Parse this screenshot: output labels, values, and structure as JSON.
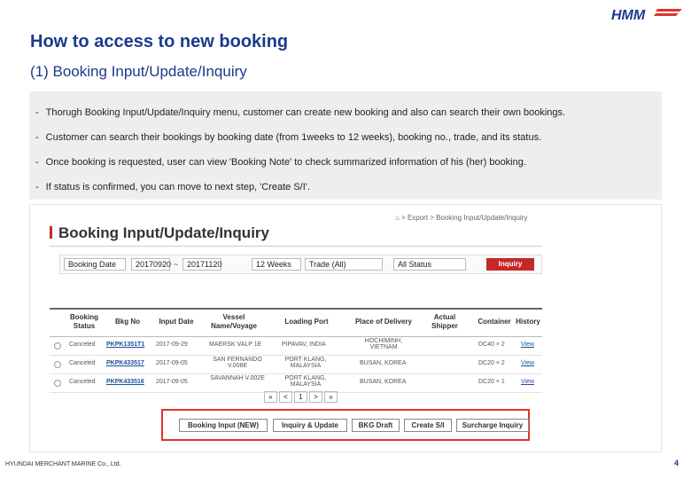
{
  "logo_text": "HMM",
  "heading": {
    "title": "How to access to new booking",
    "subtitle": "(1) Booking Input/Update/Inquiry"
  },
  "bullets": [
    "Thorugh Booking Input/Update/Inquiry menu, customer can create new booking and also can search their own bookings.",
    "Customer can search their bookings by booking date (from 1weeks to 12 weeks), booking no., trade, and its status.",
    "Once booking is requested, user can view 'Booking Note' to check summarized information of his (her) booking.",
    "If status is confirmed, you can move to next step, 'Create S/I'."
  ],
  "bullet_dash": "-",
  "screenshot": {
    "breadcrumb": "⌂ > Export > Booking Input/Update/Inquiry",
    "page_title": "Booking Input/Update/Inquiry",
    "search": {
      "date_type": "Booking Date",
      "date_from": "20170920",
      "date_sep": "~",
      "date_to": "20171120",
      "weeks": "12 Weeks",
      "trade": "Trade (All)",
      "status": "All Status",
      "inquiry_label": "Inquiry"
    },
    "columns": [
      "Booking Status",
      "Bkg No",
      "Input Date",
      "Vessel Name/Voyage",
      "Loading Port",
      "Place of Delivery",
      "Actual Shipper",
      "Container",
      "History"
    ],
    "rows": [
      {
        "status": "Canceled",
        "bkg_no": "PKPK1351T1",
        "input_date": "2017-09-29",
        "vessel": "MAERSK VALP 1E",
        "loading_port": "PIPAVAV, INDIA",
        "delivery": "HOCHIMINH, VIETNAM",
        "shipper": "",
        "container": "DC40 × 2",
        "history": "View"
      },
      {
        "status": "Canceled",
        "bkg_no": "PKPK433517",
        "input_date": "2017-09-05",
        "vessel": "SAN FERNANDO V.008E",
        "loading_port": "PORT KLANG, MALAYSIA",
        "delivery": "BUSAN, KOREA",
        "shipper": "",
        "container": "DC20 × 2",
        "history": "View"
      },
      {
        "status": "Canceled",
        "bkg_no": "PKPK433516",
        "input_date": "2017-09-05",
        "vessel": "SAVANNAH V.002E",
        "loading_port": "PORT KLANG, MALAYSIA",
        "delivery": "BUSAN, KOREA",
        "shipper": "",
        "container": "DC20 × 1",
        "history": "View"
      }
    ],
    "pager": [
      "«",
      "<",
      "1",
      ">",
      "»"
    ],
    "buttons": [
      "Booking Input (NEW)",
      "Inquiry & Update",
      "BKG Draft",
      "Create S/I",
      "Surcharge Inquiry"
    ]
  },
  "footer": "HYUNDAI MERCHANT MARINE Co., Ltd.",
  "page_number": "4",
  "colors": {
    "heading": "#1d3a8a",
    "accent_red": "#c62828",
    "highlight_border": "#e0322f",
    "bullet_bg": "#eeeeee"
  }
}
